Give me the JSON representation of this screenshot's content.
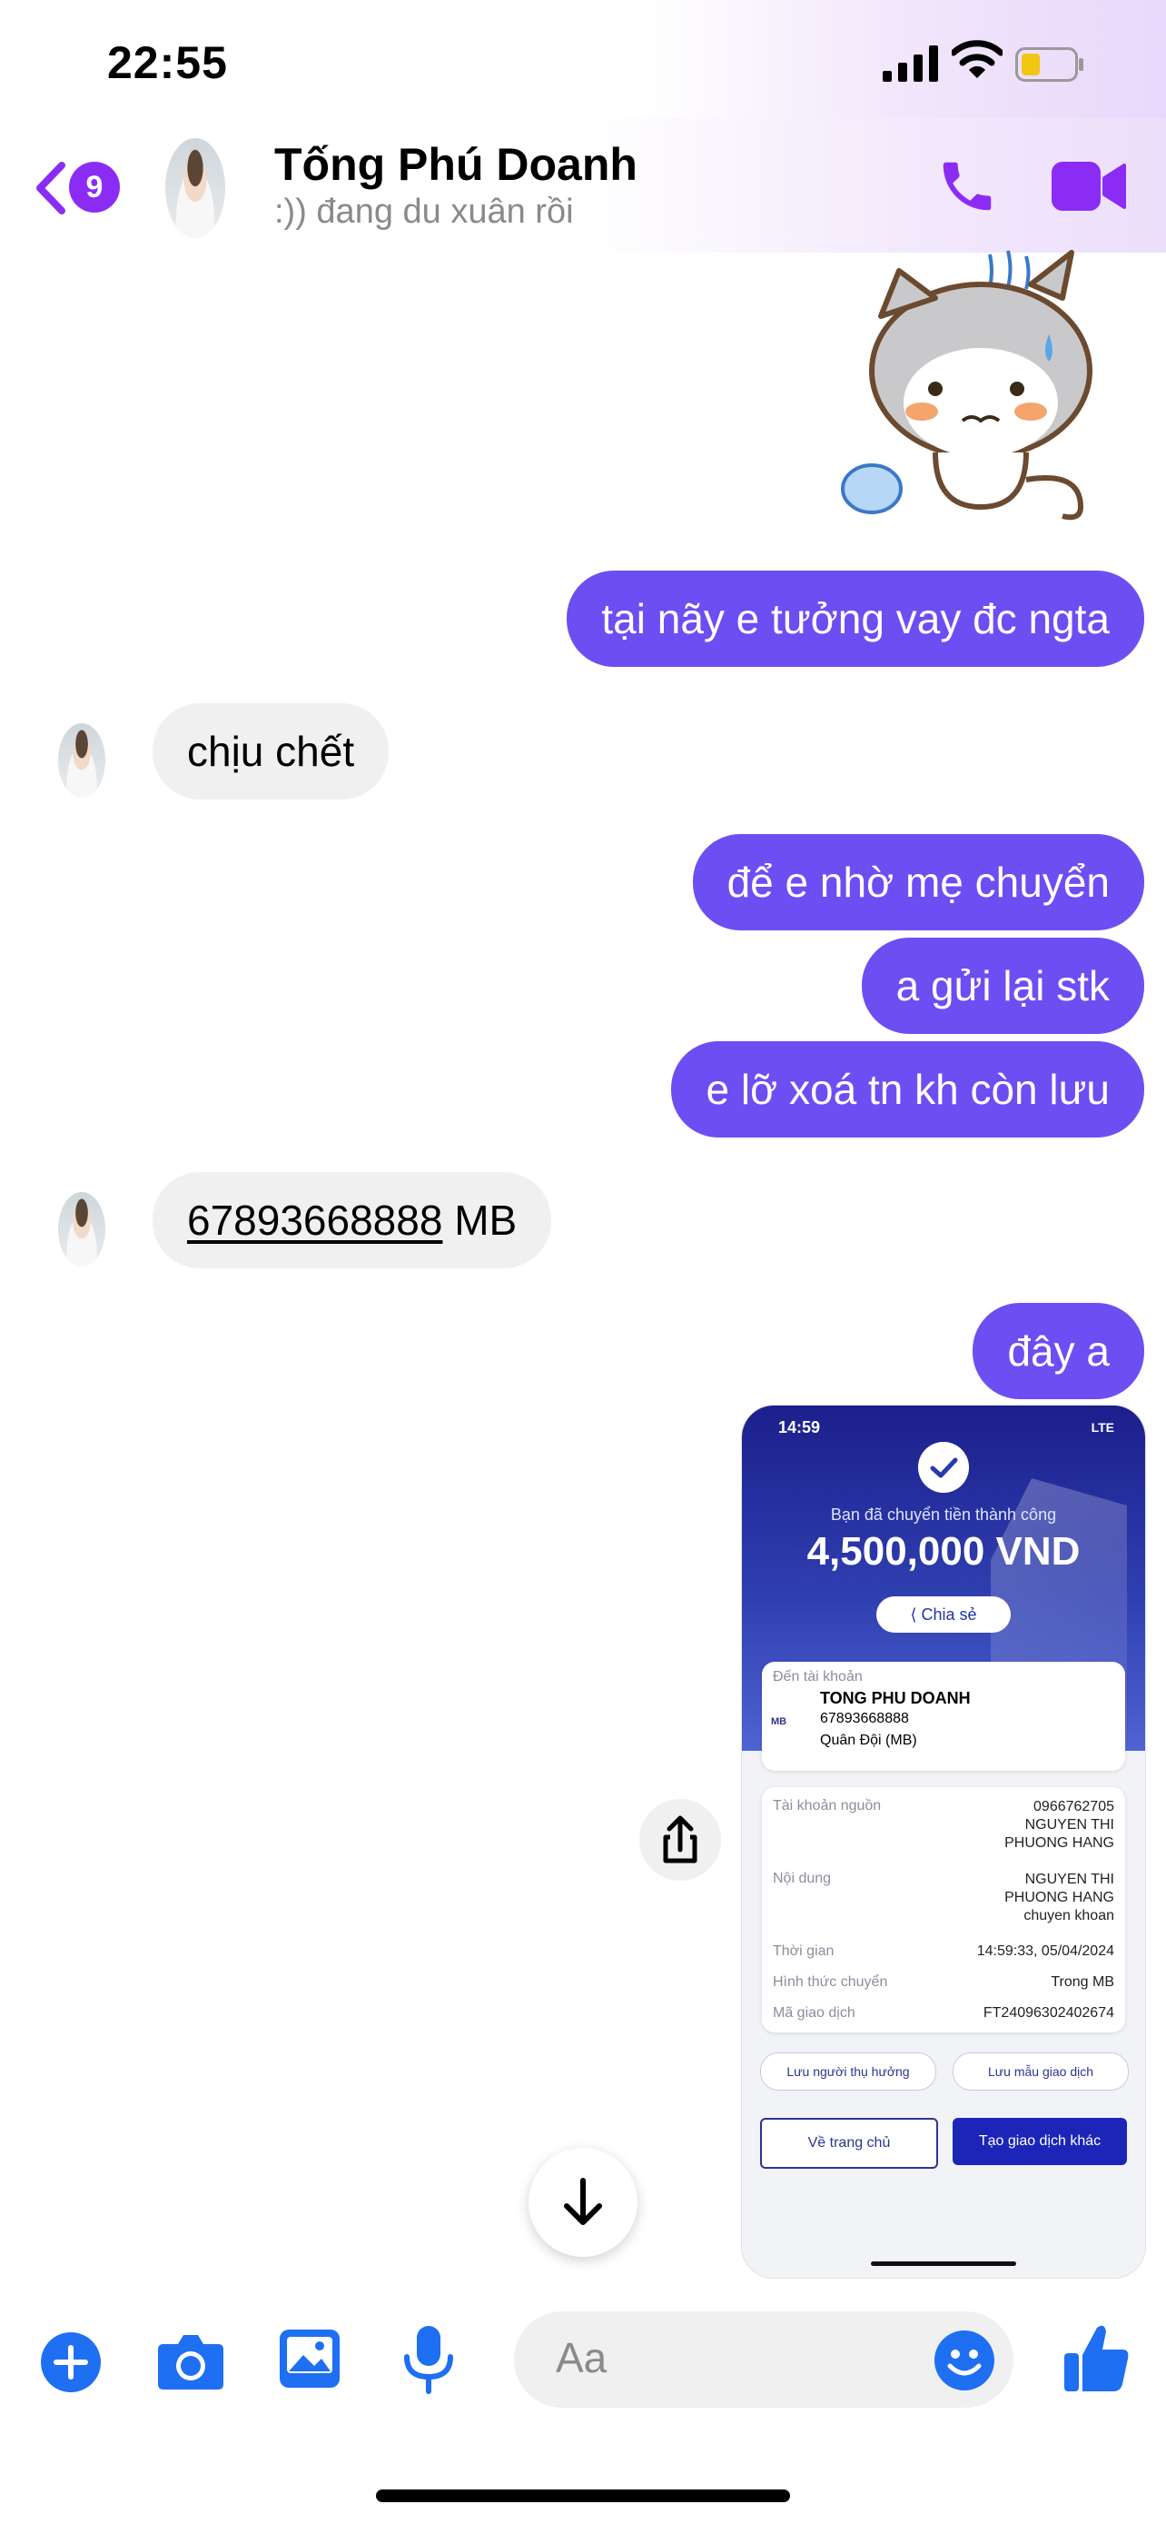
{
  "status_bar": {
    "time": "22:55"
  },
  "header": {
    "back_badge": "9",
    "contact_name": "Tống Phú Doanh",
    "contact_status": ":)) đang du xuân rồi"
  },
  "messages": [
    {
      "from": "me",
      "text": "tại nãy e tưởng vay đc ngta"
    },
    {
      "from": "them",
      "text": "chịu chết"
    },
    {
      "from": "me",
      "text": "để e nhờ mẹ chuyển"
    },
    {
      "from": "me",
      "text": "a gửi lại stk"
    },
    {
      "from": "me",
      "text": "e lỡ xoá tn kh còn lưu"
    },
    {
      "from": "them",
      "account": "67893668888",
      "bank": " MB"
    },
    {
      "from": "me",
      "text": "đây a"
    }
  ],
  "receipt": {
    "time": "14:59",
    "network": "LTE",
    "message": "Bạn đã chuyển tiền thành công",
    "amount": "4,500,000 VND",
    "share_label": "Chia sẻ",
    "to_label": "Đến tài khoản",
    "to_name": "TONG PHU DOANH",
    "to_account": "67893668888",
    "to_bank": "Quân Đội (MB)",
    "to_bank_logo": "MB",
    "rows": [
      {
        "label": "Tài khoản nguồn",
        "value": "0966762705\nNGUYEN THI\nPHUONG HANG"
      },
      {
        "label": "Nội dung",
        "value": "NGUYEN THI\nPHUONG HANG\nchuyen khoan"
      },
      {
        "label": "Thời gian",
        "value": "14:59:33, 05/04/2024"
      },
      {
        "label": "Hình thức chuyển",
        "value": "Trong MB"
      },
      {
        "label": "Mã giao dịch",
        "value": "FT24096302402674"
      }
    ],
    "save_beneficiary": "Lưu người thụ hưởng",
    "save_template": "Lưu mẫu giao dịch",
    "home_button": "Về trang chủ",
    "new_transaction": "Tạo giao dịch khác"
  },
  "composer": {
    "placeholder": "Aa"
  },
  "colors": {
    "accent": "#6c4ef2",
    "brand_icons": "#8b2cf5",
    "toolbar_blue": "#1e6ff2"
  },
  "icons": [
    "plus-icon",
    "camera-icon",
    "image-icon",
    "mic-icon",
    "emoji-icon",
    "thumbs-up-icon",
    "share-icon",
    "arrow-down-icon",
    "phone-icon",
    "video-icon",
    "back-chevron-icon"
  ]
}
